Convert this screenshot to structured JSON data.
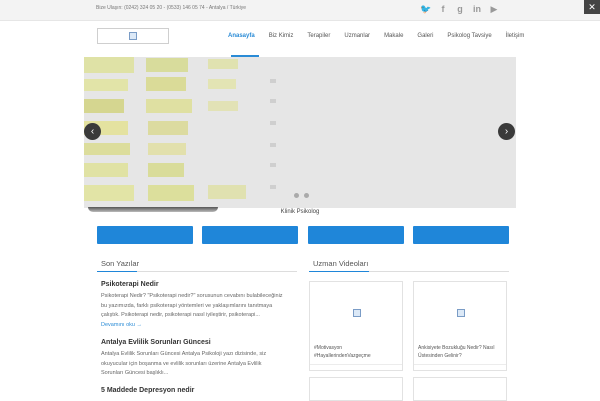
{
  "topbar": {
    "contact": "Bize Ulaşın: (0242) 324 05 20 - (0533) 146 05 74 - Antalya / Türkiye",
    "social_icons": [
      "twitter-icon",
      "facebook-icon",
      "google-plus-icon",
      "linkedin-icon",
      "youtube-icon"
    ],
    "corner_glyph": "✕"
  },
  "nav": {
    "items": [
      "Anasayfa",
      "Biz Kimiz",
      "Terapiler",
      "Uzmanlar",
      "Makale",
      "Galeri",
      "Psikolog Tavsiye",
      "İletişim"
    ],
    "active_index": 0,
    "accent": "#2a8bd6"
  },
  "slider": {
    "prev_glyph": "‹",
    "next_glyph": "›",
    "caption": "Klinik Psikolog",
    "slide_count": 2
  },
  "buttons": {
    "count": 4,
    "color": "#1f86d9"
  },
  "posts_section": {
    "title": "Son Yazılar",
    "posts": [
      {
        "title": "Psikoterapi Nedir",
        "excerpt": [
          "Psikoterapi Nedir?  \"Psikoterapi nedir?\" sorusunun cevabını bulabileceğiniz",
          "bu yazımızda, farklı psikoterapi yöntemleri ve yaklaşımlarını tanıtmaya",
          "çalıştık. Psikoterapi nedir, psikoterapi nasıl iyileştirir,  psikoterapi..."
        ],
        "more": "Devamını oku →"
      },
      {
        "title": "Antalya Evlilik Sorunları Güncesi",
        "excerpt": [
          "Antalya Evlilik Sorunları Güncesi Antalya Psikoloji yazı dizisinde, siz",
          "okuyucular için boşanma ve evlilik sorunları üzerine Antalya Evlilik",
          "Sorunları Güncesi başlıklı..."
        ],
        "more": ""
      },
      {
        "title": "5 Maddede Depresyon nedir",
        "excerpt": [],
        "more": ""
      }
    ]
  },
  "videos_section": {
    "title": "Uzman Videoları",
    "videos": [
      {
        "title": "#Motivasyon #HayallerindenVazgeçme"
      },
      {
        "title": "Ankisiyete Bozukluğu Nedir? Nasıl Üstesinden Gelinir?"
      },
      {
        "title": ""
      },
      {
        "title": ""
      }
    ]
  }
}
